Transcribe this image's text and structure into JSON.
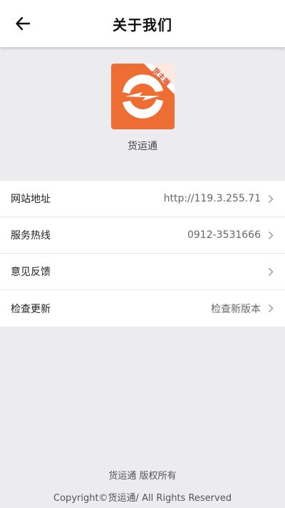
{
  "header": {
    "title": "关于我们",
    "back_icon": "arrow-left-icon"
  },
  "app": {
    "name": "货运通",
    "logo_badge": "货主端",
    "brand_color": "#ed6d33"
  },
  "list": {
    "items": [
      {
        "label": "网站地址",
        "value": "http://119.3.255.71"
      },
      {
        "label": "服务热线",
        "value": "0912-3531666"
      },
      {
        "label": "意见反馈",
        "value": ""
      },
      {
        "label": "检查更新",
        "value": "检查新版本"
      }
    ],
    "chevron_icon": "chevron-right-icon"
  },
  "footer": {
    "copyright_line1": "货运通 版权所有",
    "copyright_line2": "Copyright©货运通/ All Rights Reserved"
  }
}
